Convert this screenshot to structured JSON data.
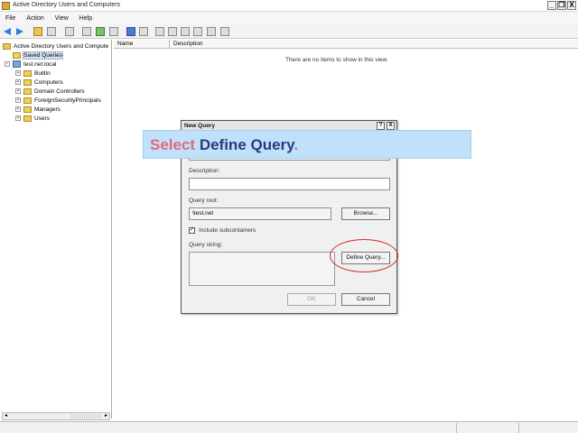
{
  "window": {
    "title": "Active Directory Users and Computers",
    "controls": [
      "_",
      "❒",
      "X"
    ]
  },
  "menu": [
    "File",
    "Action",
    "View",
    "Help"
  ],
  "tree": {
    "items": [
      {
        "label": "Active Directory Users and Compute",
        "expander": "",
        "icon": "directory-icon"
      },
      {
        "label": "Saved Queries",
        "expander": "",
        "icon": "folder-icon"
      },
      {
        "label": "test.net.local",
        "expander": "−",
        "icon": "domain-icon"
      },
      {
        "label": "Builtin",
        "expander": "+",
        "icon": "folder-icon"
      },
      {
        "label": "Computers",
        "expander": "+",
        "icon": "folder-icon"
      },
      {
        "label": "Domain Controllers",
        "expander": "+",
        "icon": "folder-icon"
      },
      {
        "label": "ForeignSecurityPrincipals",
        "expander": "+",
        "icon": "folder-icon"
      },
      {
        "label": "Managers",
        "expander": "+",
        "icon": "folder-icon"
      },
      {
        "label": "Users",
        "expander": "+",
        "icon": "folder-icon"
      }
    ]
  },
  "list": {
    "columns": [
      "Name",
      "Description"
    ],
    "empty_message": "There are no items to show in this view."
  },
  "dialog": {
    "title": "New Query",
    "help": "?",
    "close": "X",
    "description_label": "Description:",
    "description_value": "",
    "query_root_label": "Query root:",
    "query_root_value": "\\test.net",
    "browse_label": "Browse...",
    "include_subcontainers_label": "Include subcontainers",
    "include_subcontainers_check": "✓",
    "query_string_label": "Query string:",
    "define_query_label": "Define Query...",
    "ok_label": "OK",
    "cancel_label": "Cancel"
  },
  "callout": {
    "word1": "Select ",
    "word2": "Define Query",
    "word3": "."
  },
  "scroll": {
    "left": "◂",
    "right": "▸"
  },
  "colors": {
    "callout_bg": "#bfe1fb",
    "callout_accent": "#e36a7c",
    "callout_main": "#2c3a78",
    "ring": "#d42a2a"
  }
}
